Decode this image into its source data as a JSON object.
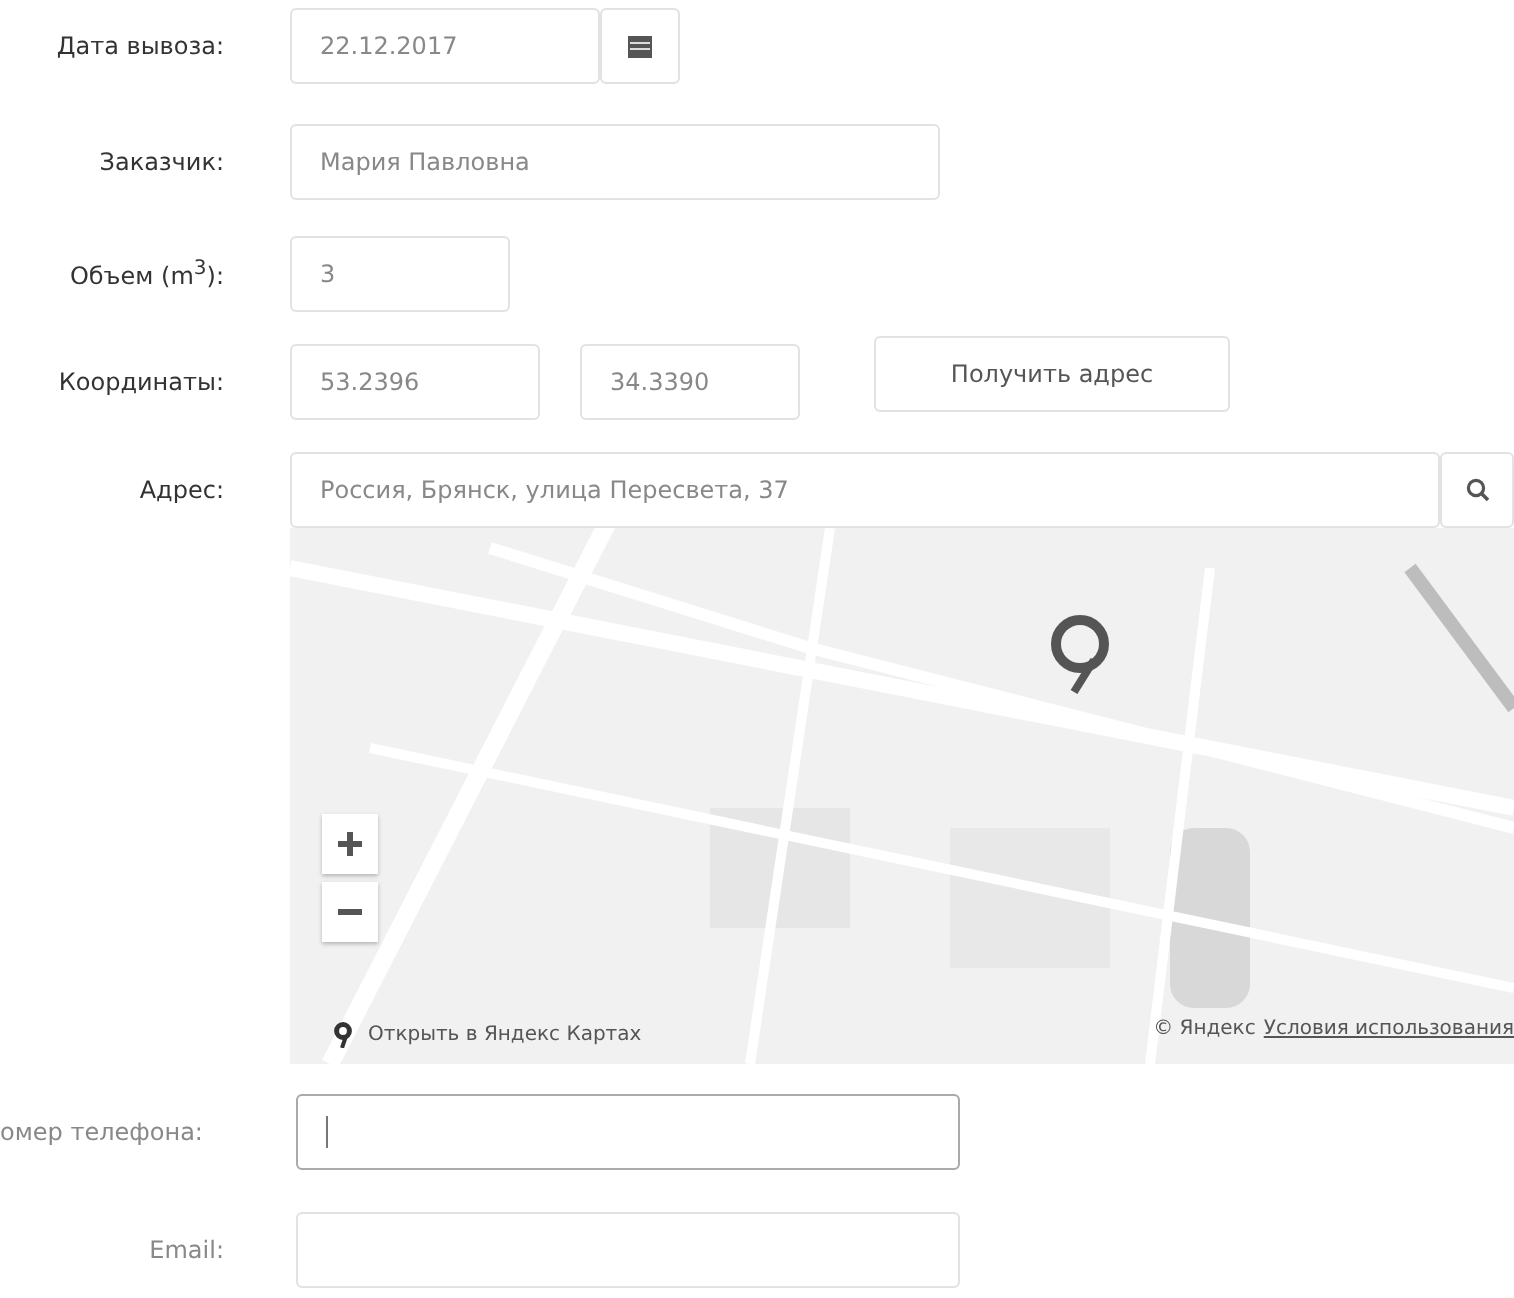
{
  "form": {
    "pickup_date": {
      "label": "Дата вывоза:",
      "value": "22.12.2017"
    },
    "customer": {
      "label": "Заказчик:",
      "value": "Мария Павловна"
    },
    "volume": {
      "label": "Объем (m$^{3}$):",
      "value": "3"
    },
    "coordinates": {
      "label": "Координаты:",
      "latitude": "53.2396",
      "longitude": "34.3390",
      "button": "Получить адрес"
    },
    "address": {
      "label": "Адрес:",
      "value": "Россия, Брянск, улица Пересвета, 37"
    },
    "map": {
      "open_link": "Открыть в Яндекс Картах",
      "copyright": "© Яндекс",
      "terms_link": "Условия использования"
    },
    "phone": {
      "label": "омер телефона:",
      "focused": true
    },
    "email": {
      "label": "Email:",
      "focused": false
    }
  }
}
